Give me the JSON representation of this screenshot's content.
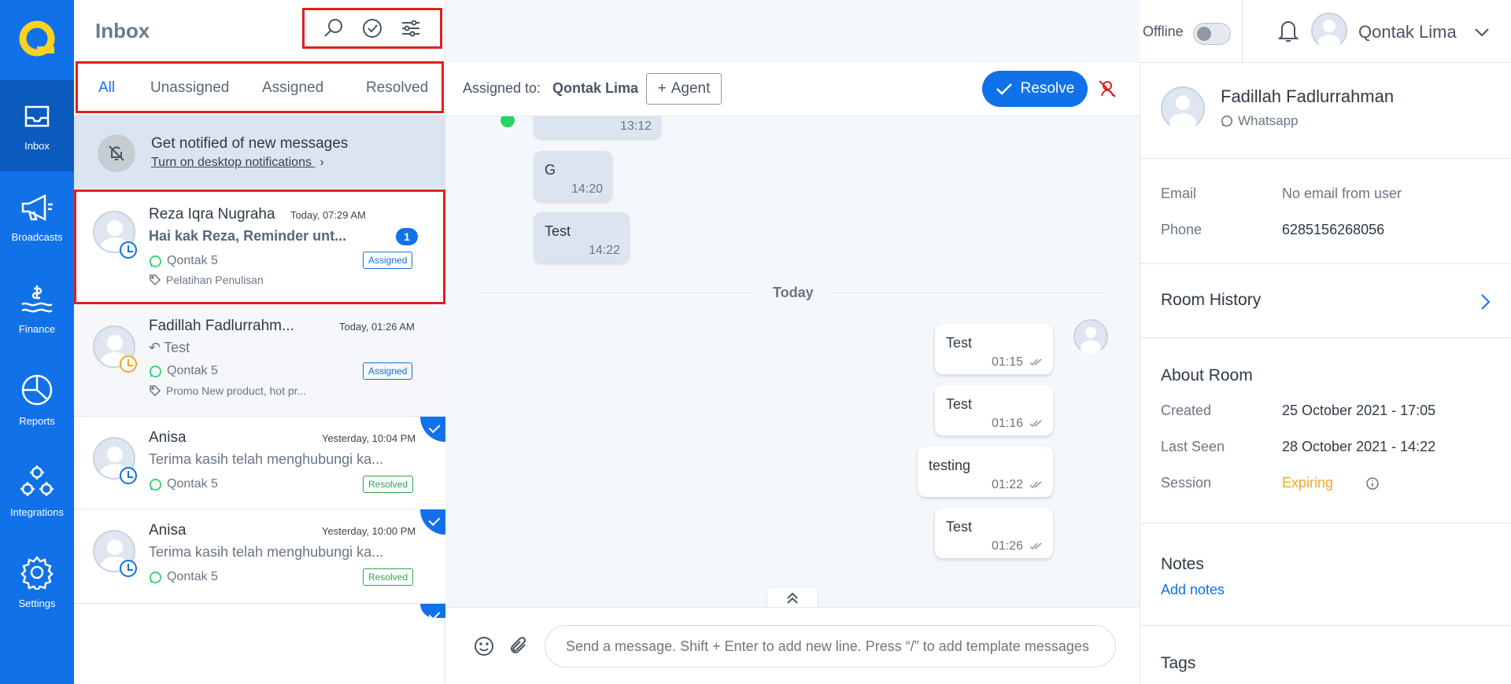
{
  "nav": {
    "items": [
      {
        "label": "Inbox",
        "icon": "inbox-icon"
      },
      {
        "label": "Broadcasts",
        "icon": "megaphone-icon"
      },
      {
        "label": "Finance",
        "icon": "finance-icon"
      },
      {
        "label": "Reports",
        "icon": "pie-chart-icon"
      },
      {
        "label": "Integrations",
        "icon": "integrations-icon"
      },
      {
        "label": "Settings",
        "icon": "gear-icon"
      }
    ]
  },
  "list": {
    "title": "Inbox",
    "tabs": [
      "All",
      "Unassigned",
      "Assigned",
      "Resolved"
    ],
    "notify": {
      "title": "Get notified of new messages",
      "link": "Turn on desktop notifications"
    },
    "conversations": [
      {
        "name": "Reza Iqra Nugraha",
        "time": "Today, 07:29 AM",
        "preview": "Hai kak Reza, Reminder unt...",
        "channel": "Qontak 5",
        "tag": "Pelatihan Penulisan",
        "status": "Assigned",
        "unread": "1"
      },
      {
        "name": "Fadillah Fadlurrahm...",
        "time": "Today, 01:26 AM",
        "preview": "Test",
        "channel": "Qontak 5",
        "tag": "Promo New product, hot pr...",
        "status": "Assigned"
      },
      {
        "name": "Anisa",
        "time": "Yesterday, 10:04 PM",
        "preview": "Terima kasih telah menghubungi ka...",
        "channel": "Qontak 5",
        "status": "Resolved"
      },
      {
        "name": "Anisa",
        "time": "Yesterday, 10:00 PM",
        "preview": "Terima kasih telah menghubungi ka...",
        "channel": "Qontak 5",
        "status": "Resolved"
      }
    ]
  },
  "topbar": {
    "status_label": "Offline",
    "user_name": "Qontak Lima"
  },
  "chat": {
    "assigned_label": "Assigned to:",
    "assigned_name": "Qontak Lima",
    "agent_button": "Agent",
    "resolve_button": "Resolve",
    "divider": "Today",
    "incoming": [
      {
        "text": "",
        "time": "13:12"
      },
      {
        "text": "G",
        "time": "14:20"
      },
      {
        "text": "Test",
        "time": "14:22"
      }
    ],
    "outgoing": [
      {
        "text": "Test",
        "time": "01:15"
      },
      {
        "text": "Test",
        "time": "01:16"
      },
      {
        "text": "testing",
        "time": "01:22"
      },
      {
        "text": "Test",
        "time": "01:26"
      }
    ],
    "input_placeholder": "Send a message. Shift + Enter to add new line. Press “/” to add template messages"
  },
  "info": {
    "contact_name": "Fadillah Fadlurrahman",
    "contact_channel": "Whatsapp",
    "email_label": "Email",
    "email_value": "No email from user",
    "phone_label": "Phone",
    "phone_value": "6285156268056",
    "room_history": "Room History",
    "about_title": "About Room",
    "created_label": "Created",
    "created_value": "25 October 2021 - 17:05",
    "last_seen_label": "Last Seen",
    "last_seen_value": "28 October 2021 - 14:22",
    "session_label": "Session",
    "session_value": "Expiring",
    "notes_title": "Notes",
    "add_notes": "Add notes",
    "tags_title": "Tags"
  },
  "colors": {
    "primary": "#1171e8",
    "resolved": "#2aa84a",
    "expiring": "#f5a623",
    "highlight": "#e02020"
  }
}
